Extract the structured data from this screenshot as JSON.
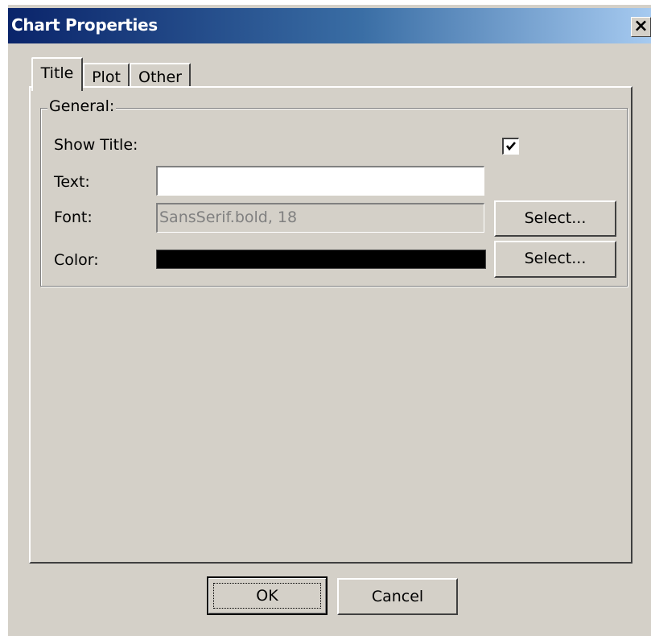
{
  "window": {
    "title": "Chart Properties",
    "close_symbol": "×"
  },
  "tabs": [
    {
      "label": "Title",
      "selected": true
    },
    {
      "label": "Plot",
      "selected": false
    },
    {
      "label": "Other",
      "selected": false
    }
  ],
  "general": {
    "legend": "General:",
    "show_title": {
      "label": "Show Title:",
      "checked": true
    },
    "text": {
      "label": "Text:",
      "value": ""
    },
    "font": {
      "label": "Font:",
      "value": "SansSerif.bold, 18",
      "button": "Select..."
    },
    "color": {
      "label": "Color:",
      "value_hex": "#000000",
      "button": "Select..."
    }
  },
  "footer": {
    "ok": "OK",
    "cancel": "Cancel"
  },
  "theme": {
    "face": "#d4d0c8",
    "title_gradient_start": "#0a246a",
    "title_gradient_end": "#a6caf0"
  }
}
